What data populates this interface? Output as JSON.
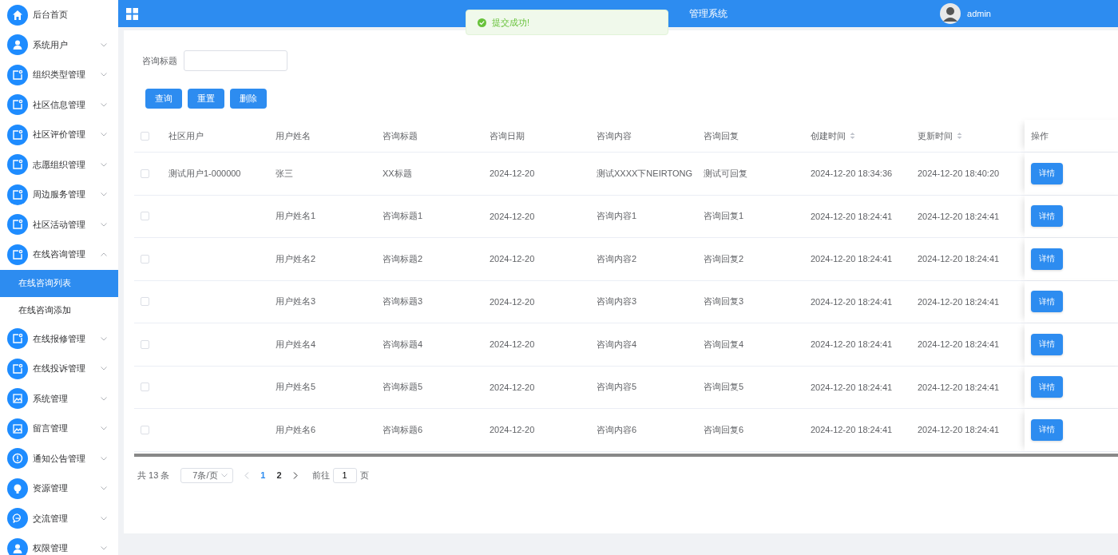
{
  "sidebar": {
    "items": [
      {
        "label": "后台首页",
        "kind": "home"
      },
      {
        "label": "系统用户",
        "kind": "user",
        "expanded": false
      },
      {
        "label": "组织类型管理",
        "kind": "note",
        "expanded": false
      },
      {
        "label": "社区信息管理",
        "kind": "note",
        "expanded": false
      },
      {
        "label": "社区评价管理",
        "kind": "note",
        "expanded": false
      },
      {
        "label": "志愿组织管理",
        "kind": "note",
        "expanded": false
      },
      {
        "label": "周边服务管理",
        "kind": "note",
        "expanded": false
      },
      {
        "label": "社区活动管理",
        "kind": "note",
        "expanded": false
      },
      {
        "label": "在线咨询管理",
        "kind": "note",
        "expanded": true,
        "children": [
          {
            "label": "在线咨询列表",
            "selected": true
          },
          {
            "label": "在线咨询添加",
            "selected": false
          }
        ]
      },
      {
        "label": "在线报修管理",
        "kind": "note",
        "expanded": false
      },
      {
        "label": "在线投诉管理",
        "kind": "note",
        "expanded": false
      },
      {
        "label": "系统管理",
        "kind": "image",
        "expanded": false
      },
      {
        "label": "留言管理",
        "kind": "image",
        "expanded": false
      },
      {
        "label": "通知公告管理",
        "kind": "info",
        "expanded": false
      },
      {
        "label": "资源管理",
        "kind": "bulb",
        "expanded": false
      },
      {
        "label": "交流管理",
        "kind": "chat",
        "expanded": false
      },
      {
        "label": "权限管理",
        "kind": "user",
        "expanded": false
      }
    ]
  },
  "header": {
    "title": "管理系统",
    "user": "admin"
  },
  "toast": {
    "message": "提交成功!"
  },
  "search": {
    "label": "咨询标题",
    "buttons": [
      "查询",
      "重置",
      "删除"
    ]
  },
  "table": {
    "select_all_checked": false,
    "columns": [
      {
        "label": "社区用户",
        "sortable": false
      },
      {
        "label": "用户姓名",
        "sortable": false
      },
      {
        "label": "咨询标题",
        "sortable": false
      },
      {
        "label": "咨询日期",
        "sortable": false
      },
      {
        "label": "咨询内容",
        "sortable": false
      },
      {
        "label": "咨询回复",
        "sortable": false
      },
      {
        "label": "创建时间",
        "sortable": true
      },
      {
        "label": "更新时间",
        "sortable": true
      }
    ],
    "action_column": "操作",
    "rows": [
      {
        "checked": false,
        "cells": [
          "测试用户1-000000",
          "张三",
          "XX标题",
          "2024-12-20",
          "测试XXXX下NEIRTONG",
          "测试可回复",
          "2024-12-20 18:34:36",
          "2024-12-20 18:40:20"
        ],
        "action": "详情"
      },
      {
        "checked": false,
        "cells": [
          "",
          "用户姓名1",
          "咨询标题1",
          "2024-12-20",
          "咨询内容1",
          "咨询回复1",
          "2024-12-20 18:24:41",
          "2024-12-20 18:24:41"
        ],
        "action": "详情"
      },
      {
        "checked": false,
        "cells": [
          "",
          "用户姓名2",
          "咨询标题2",
          "2024-12-20",
          "咨询内容2",
          "咨询回复2",
          "2024-12-20 18:24:41",
          "2024-12-20 18:24:41"
        ],
        "action": "详情"
      },
      {
        "checked": false,
        "cells": [
          "",
          "用户姓名3",
          "咨询标题3",
          "2024-12-20",
          "咨询内容3",
          "咨询回复3",
          "2024-12-20 18:24:41",
          "2024-12-20 18:24:41"
        ],
        "action": "详情"
      },
      {
        "checked": false,
        "cells": [
          "",
          "用户姓名4",
          "咨询标题4",
          "2024-12-20",
          "咨询内容4",
          "咨询回复4",
          "2024-12-20 18:24:41",
          "2024-12-20 18:24:41"
        ],
        "action": "详情"
      },
      {
        "checked": false,
        "cells": [
          "",
          "用户姓名5",
          "咨询标题5",
          "2024-12-20",
          "咨询内容5",
          "咨询回复5",
          "2024-12-20 18:24:41",
          "2024-12-20 18:24:41"
        ],
        "action": "详情"
      },
      {
        "checked": false,
        "cells": [
          "",
          "用户姓名6",
          "咨询标题6",
          "2024-12-20",
          "咨询内容6",
          "咨询回复6",
          "2024-12-20 18:24:41",
          "2024-12-20 18:24:41"
        ],
        "action": "详情"
      }
    ]
  },
  "pagination": {
    "total": "共 13 条",
    "page_size": "7条/页",
    "pages": [
      {
        "label": "1",
        "selected": true
      },
      {
        "label": "2",
        "selected": false
      }
    ],
    "goto_label": "前往",
    "goto_value": "1",
    "goto_suffix": "页"
  }
}
